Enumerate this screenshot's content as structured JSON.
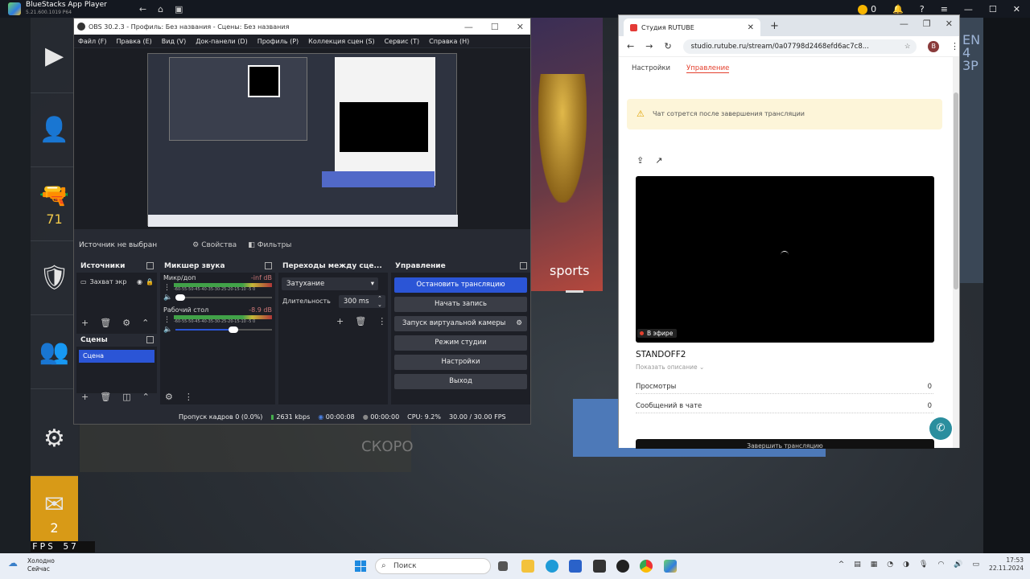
{
  "bluestacks": {
    "title": "BlueStacks App Player",
    "subtitle": "5.21.600.1019 P64",
    "coins": "0",
    "side_items": [
      {
        "name": "play",
        "glyph": "▶",
        "value": ""
      },
      {
        "name": "profile",
        "glyph": "👤",
        "value": ""
      },
      {
        "name": "weapon",
        "glyph": "🔫",
        "value": "71"
      },
      {
        "name": "armor",
        "glyph": "🛡",
        "value": ""
      },
      {
        "name": "friends",
        "glyph": "👥",
        "value": ""
      },
      {
        "name": "settings",
        "glyph": "⚙",
        "value": ""
      },
      {
        "name": "mail",
        "glyph": "✉",
        "value": "2"
      }
    ],
    "fps_label": "FPS",
    "fps_value": "57",
    "soon_text": "СКОРО",
    "promo_text": "sports",
    "right_hint_text": "EN 4 3P"
  },
  "obs": {
    "title": "OBS 30.2.3 - Профиль: Без названия - Сцены: Без названия",
    "menu": [
      "Файл (F)",
      "Правка (E)",
      "Вид (V)",
      "Док-панели (D)",
      "Профиль (P)",
      "Коллекция сцен (S)",
      "Сервис (T)",
      "Справка (H)"
    ],
    "no_source": "Источник не выбран",
    "properties": "Свойства",
    "filters": "Фильтры",
    "sources": {
      "title": "Источники",
      "items": [
        {
          "label": "Захват экр"
        }
      ]
    },
    "scenes": {
      "title": "Сцены",
      "items": [
        {
          "label": "Сцена"
        }
      ]
    },
    "mixer": {
      "title": "Микшер звука",
      "channels": [
        {
          "label": "Микр/доп",
          "db": "-inf dB",
          "volume": 0.05
        },
        {
          "label": "Рабочий стол",
          "db": "-8.9 dB",
          "volume": 0.6
        }
      ],
      "scale": "-60-55-50-45-40-35-30-25-20-15-10 -5 0"
    },
    "transitions": {
      "title": "Переходы между сце...",
      "selected": "Затухание",
      "duration_label": "Длительность",
      "duration_value": "300 ms"
    },
    "controls": {
      "title": "Управление",
      "stop_stream": "Остановить трансляцию",
      "start_record": "Начать запись",
      "virtual_cam": "Запуск виртуальной камеры",
      "studio_mode": "Режим студии",
      "settings": "Настройки",
      "exit": "Выход"
    },
    "status": {
      "dropped": "Пропуск кадров 0 (0.0%)",
      "bitrate": "2631 kbps",
      "stream_time": "00:00:08",
      "record_time": "00:00:00",
      "cpu": "CPU: 9.2%",
      "fps": "30.00 / 30.00 FPS"
    }
  },
  "chrome": {
    "tab_title": "Студия RUTUBE",
    "url": "studio.rutube.ru/stream/0a07798d2468efd6ac7c8...",
    "avatar_letter": "B",
    "page": {
      "tab_settings": "Настройки",
      "tab_control": "Управление",
      "warning": "Чат сотрется после завершения трансляции",
      "live_badge": "В эфире",
      "stream_title": "STANDOFF2",
      "show_description": "Показать описание ⌄",
      "views_label": "Просмотры",
      "views_value": "0",
      "chat_label": "Сообщений в чате",
      "chat_value": "0",
      "end_button": "Завершить трансляцию"
    }
  },
  "taskbar": {
    "weather_line1": "Холодно",
    "weather_line2": "Сейчас",
    "search_placeholder": "Поиск",
    "time": "17:53",
    "date": "22.11.2024"
  }
}
